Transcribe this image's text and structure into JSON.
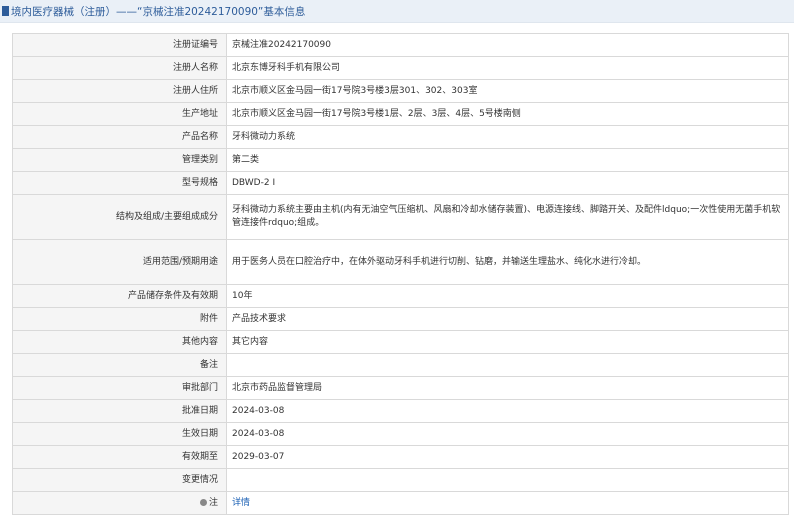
{
  "header": {
    "title": "境内医疗器械（注册）——“京械注准20242170090”基本信息"
  },
  "rows": [
    {
      "label": "注册证编号",
      "value": "京械注准20242170090"
    },
    {
      "label": "注册人名称",
      "value": "北京东博牙科手机有限公司"
    },
    {
      "label": "注册人住所",
      "value": "北京市顺义区金马园一街17号院3号楼3层301、302、303室"
    },
    {
      "label": "生产地址",
      "value": "北京市顺义区金马园一街17号院3号楼1层、2层、3层、4层、5号楼南侧"
    },
    {
      "label": "产品名称",
      "value": "牙科微动力系统"
    },
    {
      "label": "管理类别",
      "value": "第二类"
    },
    {
      "label": "型号规格",
      "value": "DBWD-2 I"
    },
    {
      "label": "结构及组成/主要组成成分",
      "value": "牙科微动力系统主要由主机(内有无油空气压缩机、风扇和冷却水储存装置)、电源连接线、脚踏开关、及配件ldquo;一次性使用无菌手机软管连接件rdquo;组成。"
    },
    {
      "label": "适用范围/预期用途",
      "value": "用于医务人员在口腔治疗中，在体外驱动牙科手机进行切削、钻磨，并输送生理盐水、纯化水进行冷却。"
    },
    {
      "label": "产品储存条件及有效期",
      "value": "10年"
    },
    {
      "label": "附件",
      "value": "产品技术要求"
    },
    {
      "label": "其他内容",
      "value": "其它内容"
    },
    {
      "label": "备注",
      "value": ""
    },
    {
      "label": "审批部门",
      "value": "北京市药品监督管理局"
    },
    {
      "label": "批准日期",
      "value": "2024-03-08"
    },
    {
      "label": "生效日期",
      "value": "2024-03-08"
    },
    {
      "label": "有效期至",
      "value": "2029-03-07"
    },
    {
      "label": "变更情况",
      "value": ""
    },
    {
      "label": "注",
      "value": "详情"
    }
  ]
}
